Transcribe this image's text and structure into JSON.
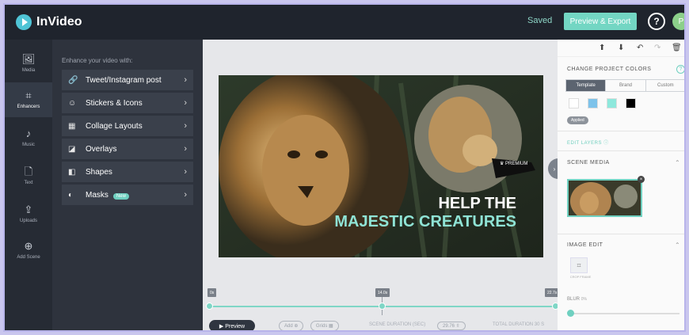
{
  "app": {
    "name": "InVideo",
    "status": "Saved",
    "export_label": "Preview & Export",
    "help": "?",
    "avatar_initial": "P"
  },
  "rail": [
    {
      "label": "Media",
      "icon": "media-icon",
      "glyph": "🖼"
    },
    {
      "label": "Enhancers",
      "icon": "enhancers-icon",
      "glyph": "⌗",
      "active": true
    },
    {
      "label": "Music",
      "icon": "music-icon",
      "glyph": "♪"
    },
    {
      "label": "Text",
      "icon": "text-icon",
      "glyph": "🗋"
    },
    {
      "label": "Uploads",
      "icon": "upload-icon",
      "glyph": "⇪"
    },
    {
      "label": "Add Scene",
      "icon": "add-scene-icon",
      "glyph": "⊕"
    }
  ],
  "panel": {
    "heading": "Enhance your video with:",
    "items": [
      {
        "label": "Tweet/Instagram post",
        "icon": "link-icon",
        "glyph": "🔗"
      },
      {
        "label": "Stickers & Icons",
        "icon": "sticker-icon",
        "glyph": "☺"
      },
      {
        "label": "Collage Layouts",
        "icon": "collage-icon",
        "glyph": "▦"
      },
      {
        "label": "Overlays",
        "icon": "overlay-icon",
        "glyph": "◪"
      },
      {
        "label": "Shapes",
        "icon": "shapes-icon",
        "glyph": "◧"
      },
      {
        "label": "Masks",
        "icon": "mask-icon",
        "glyph": "◐",
        "badge": "New"
      }
    ]
  },
  "scene": {
    "headline_line1": "HELP THE",
    "headline_line2": "MAJESTIC CREATURES",
    "premium_label": "♛ PREMIUM"
  },
  "timeline": {
    "start_tag": "0s",
    "mid_tag": "14.0s",
    "end_tag": "22.7s",
    "preview_label": "▶ Preview",
    "add_label": "Add ⊕",
    "grids_label": "Grids ▦",
    "scene_duration_label": "SCENE DURATION (SEC)",
    "scene_duration_value": "29.76 ⇳",
    "total_duration_label": "TOTAL DURATION 30 S"
  },
  "props": {
    "change_colors_title": "CHANGE PROJECT COLORS",
    "segments": [
      "Template",
      "Brand",
      "Custom"
    ],
    "active_segment": "Template",
    "swatches": [
      "#ffffff",
      "#7ec3ea",
      "#8ee8dc",
      "#000000"
    ],
    "applied": "Applied",
    "tabs": "EDIT   LAYERS ⓘ",
    "scene_media_title": "SCENE MEDIA",
    "image_edit_title": "IMAGE EDIT",
    "crop_label": "CROP FRAME",
    "blur_label": "BLUR",
    "blur_value": "0%",
    "colors": {
      "accent": "#6fd0c0",
      "dark": "#2f3540"
    }
  }
}
